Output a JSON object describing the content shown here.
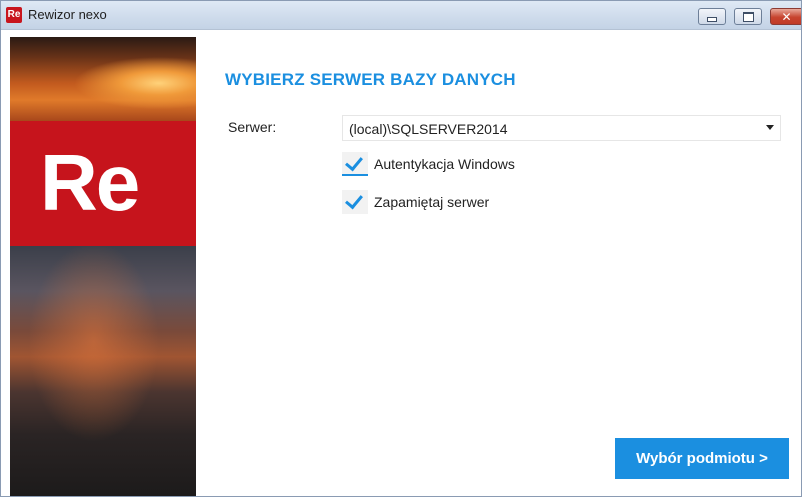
{
  "window": {
    "title": "Rewizor nexo",
    "icon_text": "Re",
    "close_glyph": "✕"
  },
  "side": {
    "logo_text": "Re"
  },
  "main": {
    "heading": "WYBIERZ SERWER BAZY DANYCH",
    "server_label": "Serwer:",
    "server_value": "(local)\\SQLSERVER2014",
    "checkboxes": [
      {
        "label": "Autentykacja Windows",
        "checked": true
      },
      {
        "label": "Zapamiętaj serwer",
        "checked": true
      }
    ],
    "next_button": "Wybór podmiotu  >"
  },
  "colors": {
    "accent": "#1b8fe0",
    "brand_red": "#c6141c"
  }
}
